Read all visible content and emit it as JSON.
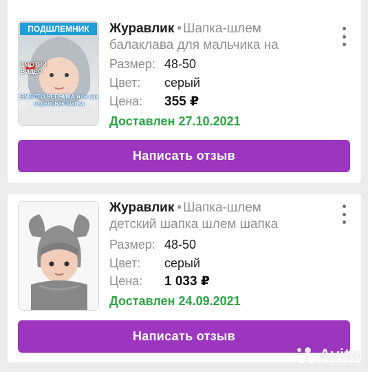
{
  "orders": [
    {
      "seller": "Журавлик",
      "title_line1": "Шапка-шлем",
      "title_line2": "балаклава для мальчика на",
      "size_label": "Размер:",
      "size": "48-50",
      "color_label": "Цвет:",
      "color": "серый",
      "price_label": "Цена:",
      "price": "355 ₽",
      "delivery": "Доставлен 27.10.2021",
      "thumb_text_top": "ПОДШЛЕМНИК",
      "thumb_text_video": "СМОТРИ ВИДЕО",
      "thumb_text_bottom": "ВМЕСТО ЧЕПЧИКА или как отдельная шапка",
      "button": "Написать отзыв"
    },
    {
      "seller": "Журавлик",
      "title_line1": "Шапка-шлем",
      "title_line2": "детский шапка шлем шапка",
      "size_label": "Размер:",
      "size": "48-50",
      "color_label": "Цвет:",
      "color": "серый",
      "price_label": "Цена:",
      "price": "1 033 ₽",
      "delivery": "Доставлен 24.09.2021",
      "button": "Написать отзыв"
    }
  ],
  "watermark": "Avito",
  "colors": {
    "accent_button": "#9c36bf",
    "delivered_green": "#2aa742",
    "page_bg": "#ececec"
  }
}
